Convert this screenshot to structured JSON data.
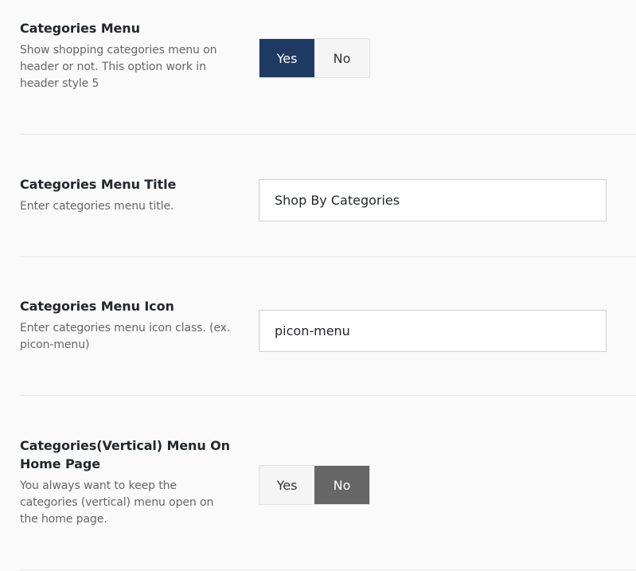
{
  "settings": [
    {
      "title": "Categories Menu",
      "description": "Show shopping categories menu on header or not. This option work in header style 5",
      "control": "toggle",
      "options": [
        "Yes",
        "No"
      ],
      "selected": "Yes",
      "accent": "#1e3a63"
    },
    {
      "title": "Categories Menu Title",
      "description": "Enter categories menu title.",
      "control": "text",
      "value": "Shop By Categories"
    },
    {
      "title": "Categories Menu Icon",
      "description": "Enter categories menu icon class. (ex. picon-menu)",
      "control": "text",
      "value": "picon-menu"
    },
    {
      "title": "Categories(Vertical) Menu On Home Page",
      "description": "You always want to keep the categories (vertical) menu open on the home page.",
      "control": "toggle",
      "options": [
        "Yes",
        "No"
      ],
      "selected": "No",
      "accent": "#666666"
    }
  ]
}
